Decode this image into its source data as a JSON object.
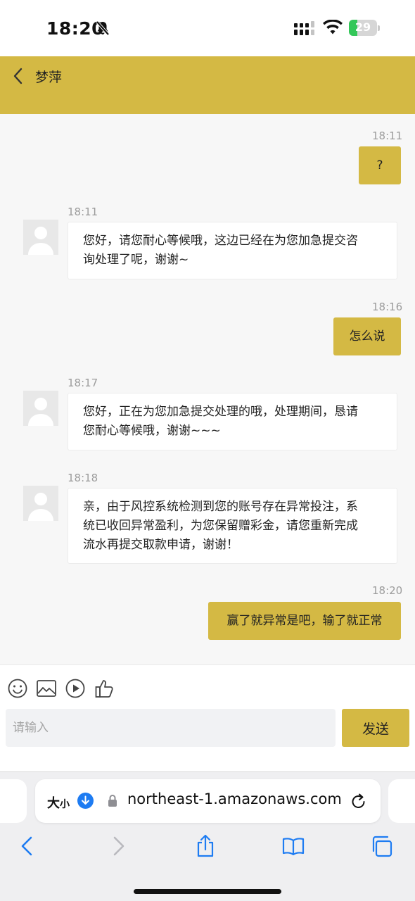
{
  "status_bar": {
    "time": "18:20",
    "battery": "29",
    "battery_level": 0.29
  },
  "header": {
    "title": "梦萍"
  },
  "messages": [
    {
      "time": "18:11",
      "direction": "out",
      "text": "?"
    },
    {
      "time": "18:11",
      "direction": "in",
      "lines": [
        "您好，请您耐心等候哦，这边已经在为您加急提交咨",
        "询处理了呢，谢谢~"
      ]
    },
    {
      "time": "18:16",
      "direction": "out",
      "text": "怎么说"
    },
    {
      "time": "18:17",
      "direction": "in",
      "lines": [
        "您好，正在为您加急提交处理的哦，处理期间，恳请",
        "您耐心等候哦，谢谢~~~"
      ]
    },
    {
      "time": "18:18",
      "direction": "in",
      "lines": [
        "亲，由于风控系统检测到您的账号存在异常投注，系",
        "统已收回异常盈利，为您保留赠彩金，请您重新完成",
        "流水再提交取款申请，谢谢！"
      ]
    },
    {
      "time": "18:20",
      "direction": "out",
      "text": "赢了就异常是吧，输了就正常"
    }
  ],
  "toolbar": {
    "icons": [
      "emoji-icon",
      "image-icon",
      "video-icon",
      "thumbs-up-icon"
    ]
  },
  "input": {
    "placeholder": "请输入",
    "value": ""
  },
  "send_label": "发送",
  "browser": {
    "size_label": "大",
    "size_label_small": "小",
    "url": "northeast-1.amazonaws.com"
  },
  "colors": {
    "accent": "#d4b944",
    "ios_blue": "#1e7cf2",
    "battery_green": "#34c759"
  }
}
